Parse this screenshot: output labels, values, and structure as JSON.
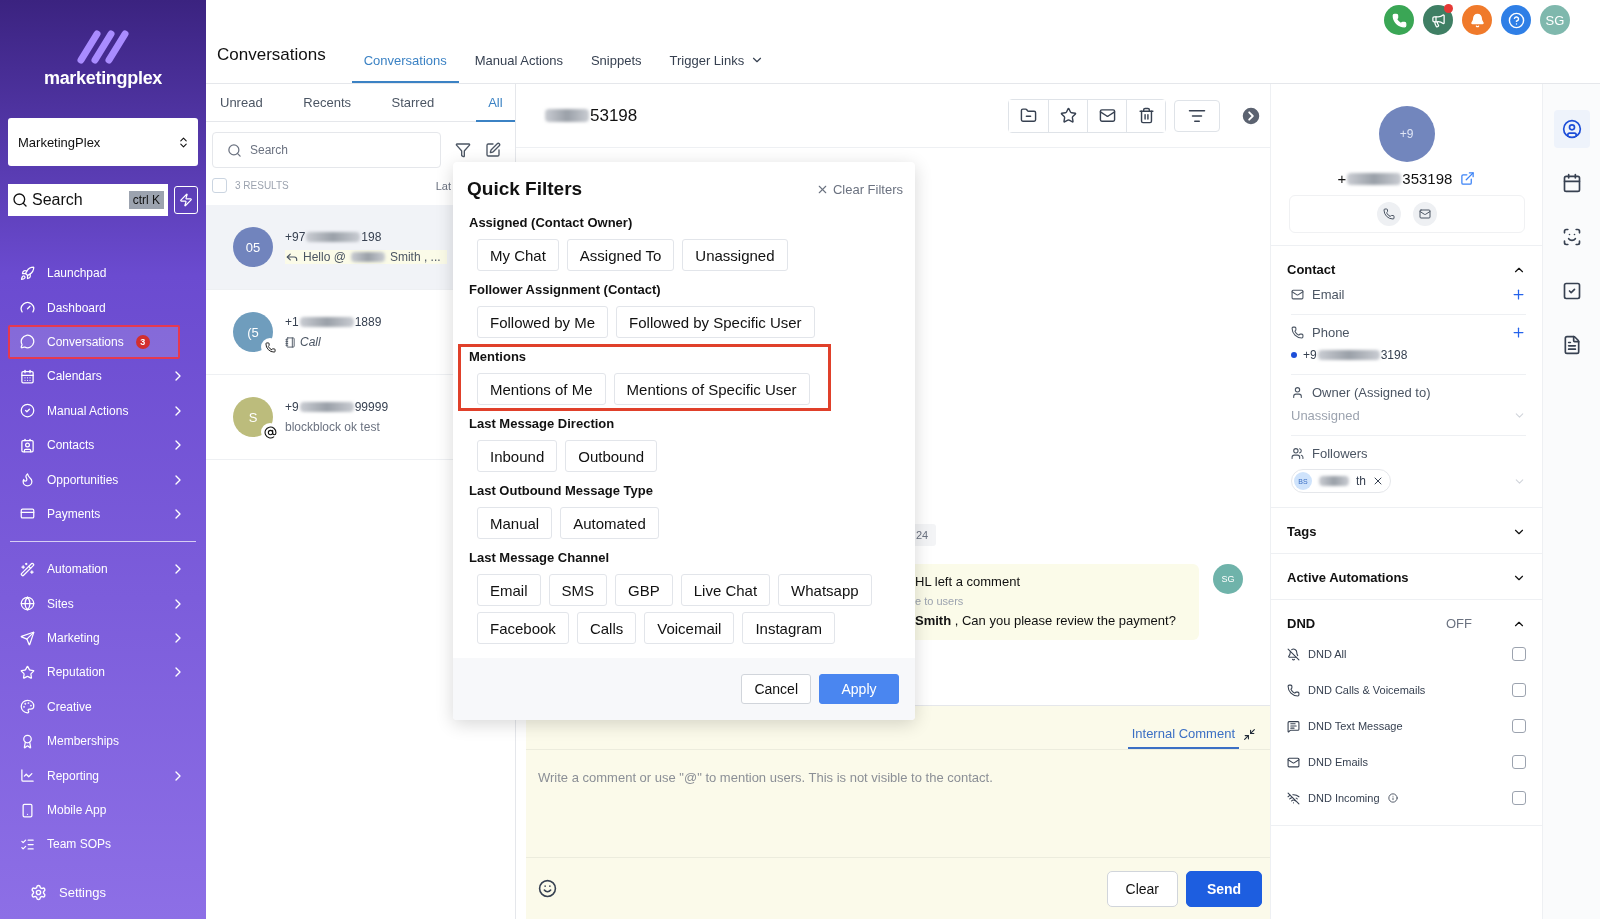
{
  "sidebar": {
    "logo": "marketingplex",
    "account": "MarketingPlex",
    "search": {
      "placeholder": "Search",
      "shortcut": "ctrl K"
    },
    "groups": [
      [
        {
          "label": "Launchpad",
          "submenu": false,
          "selected": false,
          "highlighted": false
        },
        {
          "label": "Dashboard",
          "submenu": false,
          "selected": false,
          "highlighted": false
        },
        {
          "label": "Conversations",
          "submenu": false,
          "selected": true,
          "highlighted": true,
          "badge": "3"
        },
        {
          "label": "Calendars",
          "submenu": true,
          "selected": false,
          "highlighted": false
        },
        {
          "label": "Manual Actions",
          "submenu": true,
          "selected": false,
          "highlighted": false
        },
        {
          "label": "Contacts",
          "submenu": true,
          "selected": false,
          "highlighted": false
        },
        {
          "label": "Opportunities",
          "submenu": true,
          "selected": false,
          "highlighted": false
        },
        {
          "label": "Payments",
          "submenu": true,
          "selected": false,
          "highlighted": false
        }
      ],
      [
        {
          "label": "Automation",
          "submenu": true,
          "selected": false,
          "highlighted": false
        },
        {
          "label": "Sites",
          "submenu": true,
          "selected": false,
          "highlighted": false
        },
        {
          "label": "Marketing",
          "submenu": true,
          "selected": false,
          "highlighted": false
        },
        {
          "label": "Reputation",
          "submenu": true,
          "selected": false,
          "highlighted": false
        },
        {
          "label": "Creative",
          "submenu": false,
          "selected": false,
          "highlighted": false
        },
        {
          "label": "Memberships",
          "submenu": false,
          "selected": false,
          "highlighted": false
        },
        {
          "label": "Reporting",
          "submenu": true,
          "selected": false,
          "highlighted": false
        },
        {
          "label": "Mobile App",
          "submenu": false,
          "selected": false,
          "highlighted": false
        },
        {
          "label": "Team SOPs",
          "submenu": false,
          "selected": false,
          "highlighted": false
        }
      ]
    ],
    "settings": "Settings"
  },
  "header": {
    "title": "Conversations",
    "tabs": [
      {
        "label": "Conversations",
        "selected": true,
        "dropdown": false
      },
      {
        "label": "Manual Actions",
        "selected": false,
        "dropdown": false
      },
      {
        "label": "Snippets",
        "selected": false,
        "dropdown": false
      },
      {
        "label": "Trigger Links",
        "selected": false,
        "dropdown": true
      }
    ],
    "profile": "SG",
    "notification_dot": true
  },
  "list": {
    "tabs": [
      {
        "label": "Unread",
        "selected": false
      },
      {
        "label": "Recents",
        "selected": false
      },
      {
        "label": "Starred",
        "selected": false
      },
      {
        "label": "All",
        "selected": true
      }
    ],
    "search": {
      "placeholder": "Search"
    },
    "select_all": {
      "checked": false
    },
    "results": "3 RESULTS",
    "sort": "Lat",
    "items": [
      {
        "avatar": "05",
        "color": "#7184bd",
        "selected": true,
        "kind": "reply",
        "name": [
          {
            "text": "+97"
          },
          {
            "kind": "redacted"
          },
          {
            "text": "198"
          }
        ],
        "preview": [
          {
            "text": "Hello @"
          },
          {
            "kind": "redacted"
          },
          {
            "text": "Smith , ..."
          }
        ]
      },
      {
        "avatar": "(5",
        "color": "#6f9dbd",
        "selected": false,
        "kind": "call",
        "name": [
          {
            "text": "+1"
          },
          {
            "kind": "redacted"
          },
          {
            "text": "1889"
          }
        ],
        "preview": [
          {
            "text": "Call"
          }
        ]
      },
      {
        "avatar": "S",
        "color": "#bcbc7c",
        "selected": false,
        "kind": "mention",
        "name": [
          {
            "text": "+9"
          },
          {
            "kind": "redacted"
          },
          {
            "text": "99999"
          }
        ],
        "preview": [
          {
            "text": "blockblock ok test"
          }
        ]
      }
    ]
  },
  "chat": {
    "title": [
      {
        "kind": "redacted"
      },
      {
        "text": "53198"
      }
    ],
    "date": "24",
    "comment": {
      "heading": "HL left a comment",
      "note": "e to users",
      "body": "**Smith** , Can you please review the payment?",
      "avatar": "SG"
    },
    "composer": {
      "tab": {
        "label": "Internal Comment",
        "selected": true
      },
      "placeholder": "Write a comment or use \"@\" to mention users. This is not visible to the contact.",
      "clear": "Clear",
      "send": "Send"
    }
  },
  "quick_filters": {
    "title": "Quick Filters",
    "clear": "Clear Filters",
    "sections": [
      {
        "title": "Assigned (Contact Owner)",
        "highlighted": false,
        "options": [
          {
            "label": "My Chat",
            "selected": false
          },
          {
            "label": "Assigned To",
            "selected": false
          },
          {
            "label": "Unassigned",
            "selected": false
          }
        ]
      },
      {
        "title": "Follower Assignment (Contact)",
        "highlighted": false,
        "options": [
          {
            "label": "Followed by Me",
            "selected": false
          },
          {
            "label": "Followed by Specific User",
            "selected": false
          }
        ]
      },
      {
        "title": "Mentions",
        "highlighted": true,
        "options": [
          {
            "label": "Mentions of Me",
            "selected": false
          },
          {
            "label": "Mentions of Specific User",
            "selected": false
          }
        ]
      },
      {
        "title": "Last Message Direction",
        "highlighted": false,
        "options": [
          {
            "label": "Inbound",
            "selected": false
          },
          {
            "label": "Outbound",
            "selected": false
          }
        ]
      },
      {
        "title": "Last Outbound Message Type",
        "highlighted": false,
        "options": [
          {
            "label": "Manual",
            "selected": false
          },
          {
            "label": "Automated",
            "selected": false
          }
        ]
      },
      {
        "title": "Last Message Channel",
        "highlighted": false,
        "options": [
          {
            "label": "Email",
            "selected": false
          },
          {
            "label": "SMS",
            "selected": false
          },
          {
            "label": "GBP",
            "selected": false
          },
          {
            "label": "Live Chat",
            "selected": false
          },
          {
            "label": "Whatsapp",
            "selected": false
          },
          {
            "label": "Facebook",
            "selected": false
          },
          {
            "label": "Calls",
            "selected": false
          },
          {
            "label": "Voicemail",
            "selected": false
          },
          {
            "label": "Instagram",
            "selected": false
          }
        ]
      }
    ],
    "cancel": "Cancel",
    "apply": "Apply"
  },
  "contact": {
    "avatar": "+9",
    "phone": [
      {
        "text": "+"
      },
      {
        "kind": "redacted"
      },
      {
        "text": "353198"
      }
    ],
    "section": {
      "title": "Contact",
      "expanded": true
    },
    "email_label": "Email",
    "phone_label": "Phone",
    "phone_value": [
      {
        "text": "+9"
      },
      {
        "kind": "redacted"
      },
      {
        "text": "3198"
      }
    ],
    "owner_label": "Owner (Assigned to)",
    "owner_value": "Unassigned",
    "followers_label": "Followers",
    "follower": {
      "initials": "BS",
      "name": [
        {
          "kind": "redacted"
        },
        {
          "text": "th"
        }
      ]
    },
    "collapsed_sections": [
      {
        "title": "Tags",
        "expanded": false
      },
      {
        "title": "Active Automations",
        "expanded": false
      }
    ],
    "dnd": {
      "title": "DND",
      "status": "OFF",
      "expanded": true,
      "items": [
        {
          "label": "DND All",
          "checked": false,
          "info": false
        },
        {
          "label": "DND Calls & Voicemails",
          "checked": false,
          "info": false
        },
        {
          "label": "DND Text Message",
          "checked": false,
          "info": false
        },
        {
          "label": "DND Emails",
          "checked": false,
          "info": false
        },
        {
          "label": "DND Incoming",
          "checked": false,
          "info": true
        }
      ]
    }
  },
  "rail": {
    "items": [
      {
        "selected": true
      },
      {
        "selected": false
      },
      {
        "selected": false
      },
      {
        "selected": false
      },
      {
        "selected": false
      }
    ]
  }
}
